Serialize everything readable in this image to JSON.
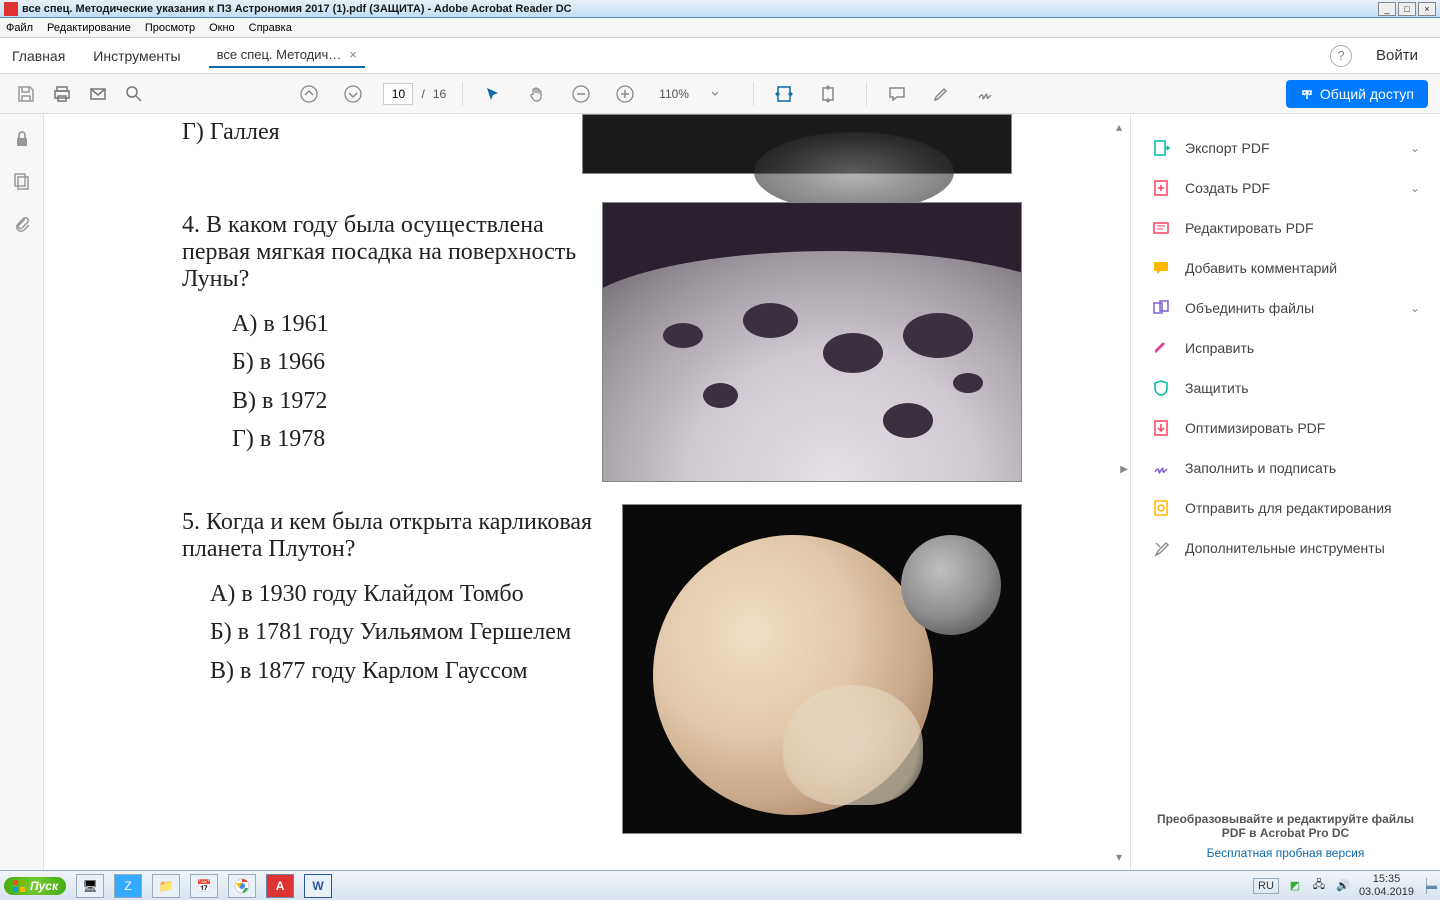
{
  "titlebar": {
    "text": "все спец. Методические указания к ПЗ Астрономия 2017 (1).pdf (ЗАЩИТА) - Adobe Acrobat Reader DC"
  },
  "menubar": [
    "Файл",
    "Редактирование",
    "Просмотр",
    "Окно",
    "Справка"
  ],
  "navtabs": {
    "home": "Главная",
    "tools": "Инструменты",
    "doc": "все спец. Методич…",
    "login": "Войти"
  },
  "toolbar": {
    "page_current": "10",
    "page_sep": "/",
    "page_total": "16",
    "zoom": "110%",
    "share": "Общий доступ"
  },
  "doc": {
    "partial": "Г) Галлея",
    "q4": {
      "text": "4. В каком году была осуществлена первая мягкая посадка на поверхность Луны?",
      "opts": [
        "А) в 1961",
        "Б) в 1966",
        "В) в 1972",
        "Г) в 1978"
      ]
    },
    "q5": {
      "text": "5. Когда и кем была открыта карлико­вая планета Плутон?",
      "opts": [
        "А) в 1930 году  Клайдом Томбо",
        "Б) в 1781 году Уильямом Гершелем",
        "В) в 1877 году Карлом Гауссом"
      ]
    }
  },
  "rightpanel": {
    "items": [
      {
        "label": "Экспорт PDF",
        "color": "#00b8a0",
        "chev": true
      },
      {
        "label": "Создать PDF",
        "color": "#ff4060",
        "chev": true
      },
      {
        "label": "Редактировать PDF",
        "color": "#ff4060",
        "chev": false
      },
      {
        "label": "Добавить комментарий",
        "color": "#ffb800",
        "chev": false
      },
      {
        "label": "Объединить файлы",
        "color": "#8060d0",
        "chev": true
      },
      {
        "label": "Исправить",
        "color": "#e040a0",
        "chev": false
      },
      {
        "label": "Защитить",
        "color": "#00b8a0",
        "chev": false
      },
      {
        "label": "Оптимизировать PDF",
        "color": "#ff4060",
        "chev": false
      },
      {
        "label": "Заполнить и подписать",
        "color": "#8060d0",
        "chev": false
      },
      {
        "label": "Отправить для редактирования",
        "color": "#ffb800",
        "chev": false
      },
      {
        "label": "Дополнительные инструменты",
        "color": "#909090",
        "chev": false
      }
    ],
    "promo1": "Преобразовывайте и редактируйте файлы PDF в Acrobat Pro DC",
    "promo2": "Бесплатная пробная версия"
  },
  "taskbar": {
    "start": "Пуск",
    "lang": "RU",
    "time": "15:35",
    "date": "03.04.2019"
  }
}
